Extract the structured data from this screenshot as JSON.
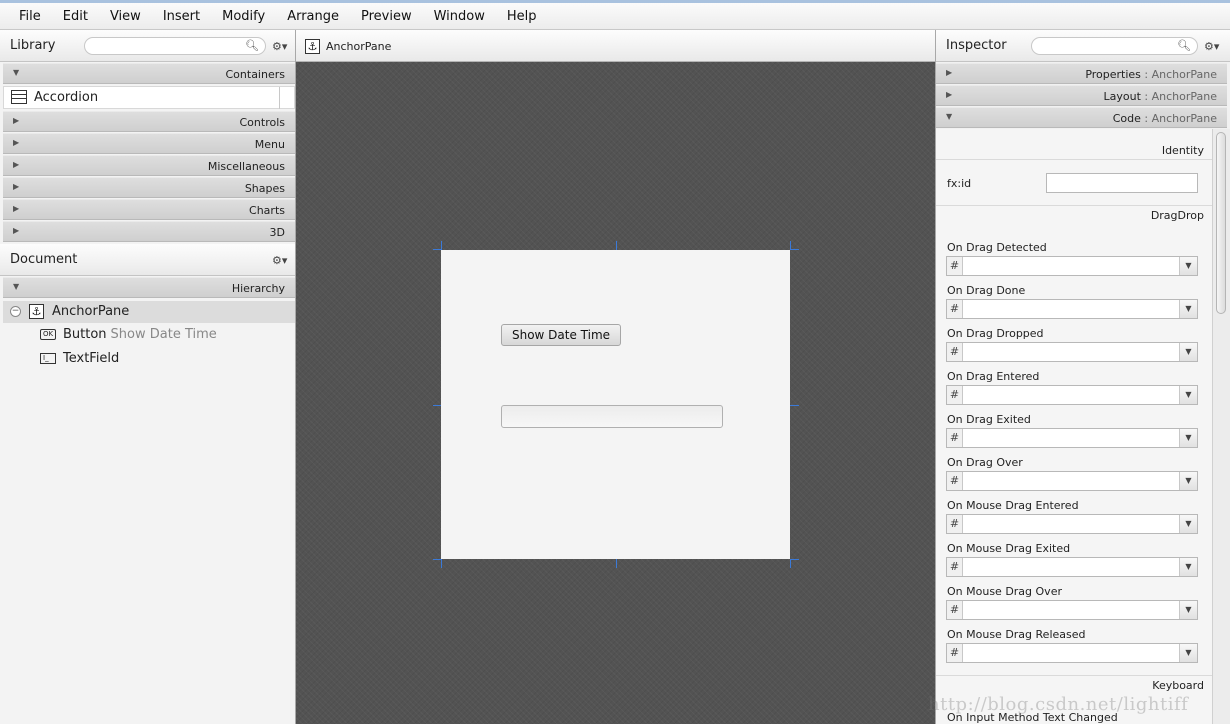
{
  "menu": [
    "File",
    "Edit",
    "View",
    "Insert",
    "Modify",
    "Arrange",
    "Preview",
    "Window",
    "Help"
  ],
  "library": {
    "title": "Library",
    "gear": "⚙▾",
    "sections": {
      "containers": "Containers",
      "controls": "Controls",
      "menu": "Menu",
      "miscellaneous": "Miscellaneous",
      "shapes": "Shapes",
      "charts": "Charts",
      "three_d": "3D"
    },
    "containers_items": [
      "Accordion"
    ]
  },
  "document": {
    "title": "Document",
    "gear": "⚙▾",
    "hierarchy_label": "Hierarchy",
    "tree": {
      "root": "AnchorPane",
      "button_type": "Button",
      "button_text": "Show Date Time",
      "textfield_type": "TextField"
    }
  },
  "center": {
    "selected": "AnchorPane",
    "canvas_button_label": "Show Date Time"
  },
  "inspector": {
    "title": "Inspector",
    "gear": "⚙▾",
    "sections": {
      "properties": "Properties",
      "layout": "Layout",
      "code": "Code",
      "target": "AnchorPane"
    },
    "identity_label": "Identity",
    "fxid_label": "fx:id",
    "dragdrop_label": "DragDrop",
    "keyboard_label": "Keyboard",
    "hash": "#",
    "events": [
      "On Drag Detected",
      "On Drag Done",
      "On Drag Dropped",
      "On Drag Entered",
      "On Drag Exited",
      "On Drag Over",
      "On Mouse Drag Entered",
      "On Mouse Drag Exited",
      "On Mouse Drag Over",
      "On Mouse Drag Released"
    ],
    "keyboard_event": "On Input Method Text Changed"
  },
  "watermark": "http://blog.csdn.net/lightiff",
  "icons": {
    "search": "search-icon",
    "gear": "gear-icon",
    "anchor": "anchor-pane-icon",
    "button": "button-icon",
    "textfield": "textfield-icon",
    "accordion": "accordion-icon",
    "expand": "triangle-right-icon",
    "collapse": "triangle-down-icon"
  },
  "colors": {
    "canvas_bg": "#535353",
    "handle": "#3b7ad8",
    "section_bar": "#d4d4d4"
  }
}
